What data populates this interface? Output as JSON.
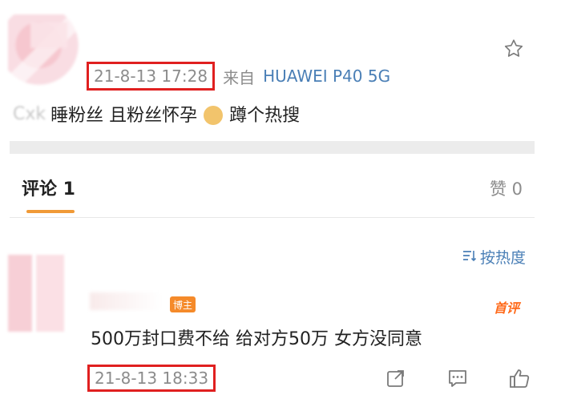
{
  "post": {
    "timestamp": "21-8-13 17:28",
    "source_prefix": "来自",
    "source_device": "HUAWEI P40 5G",
    "text_prefix_blurred": "Cxk",
    "text_main": "睡粉丝 且粉丝怀孕",
    "text_suffix": "蹲个热搜",
    "emoji": "doge-emoji"
  },
  "tabs": {
    "comments": "评论 1",
    "likes": "赞 0"
  },
  "sort": {
    "label": "按热度",
    "icon": "sort-icon"
  },
  "comment": {
    "author_badge": "博主",
    "first_badge": "首评",
    "text": "500万封口费不给 给对方50万 女方没同意",
    "timestamp": "21-8-13 18:33"
  },
  "colors": {
    "highlight_box": "#e02020",
    "link_blue": "#4a7fb6",
    "tab_accent": "#f09a37",
    "badge_orange": "#f58a2a"
  }
}
